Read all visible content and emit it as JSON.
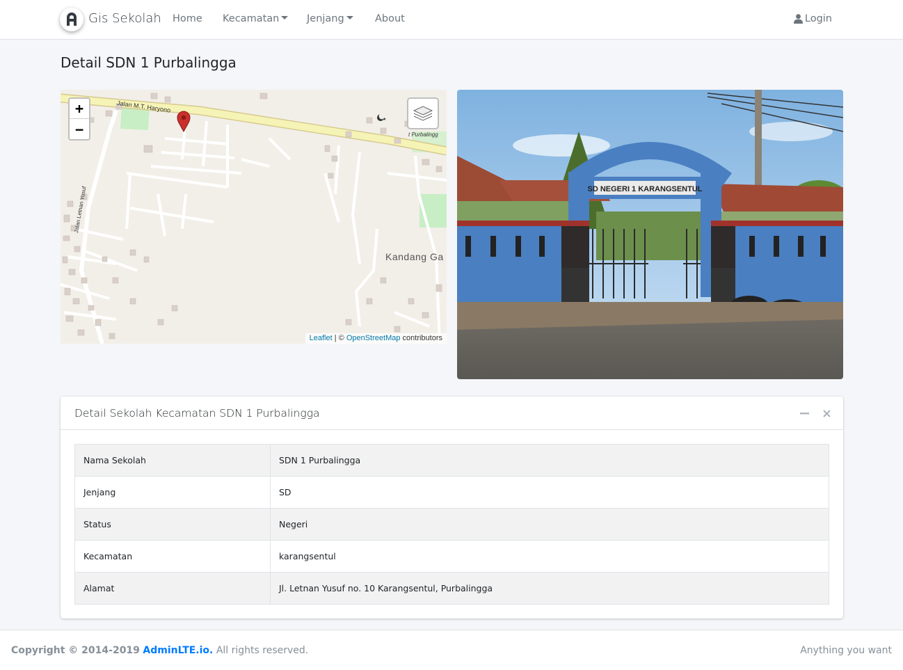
{
  "navbar": {
    "brand": "Gis Sekolah",
    "items": [
      {
        "label": "Home"
      },
      {
        "label": "Kecamatan"
      },
      {
        "label": "Jenjang"
      },
      {
        "label": "About"
      }
    ],
    "login_label": "Login"
  },
  "page": {
    "title": "Detail SDN 1 Purbalingga"
  },
  "map": {
    "zoom_in": "+",
    "zoom_out": "−",
    "street_label_1": "Jalan M.T. Haryono",
    "street_label_2": "Jalan Letnan Yusuf",
    "street_label_3": "t Purbalingg",
    "place_label": "Kandang Ga",
    "attribution_leaflet": "Leaflet",
    "attribution_sep": " | © ",
    "attribution_osm": "OpenStreetMap",
    "attribution_suffix": " contributors"
  },
  "photo": {
    "gate_sign": "SD NEGERI 1 KARANGSENTUL"
  },
  "detail_card": {
    "title": "Detail Sekolah Kecamatan SDN 1 Purbalingga",
    "rows": [
      {
        "key": "Nama Sekolah",
        "value": "SDN 1 Purbalingga"
      },
      {
        "key": "Jenjang",
        "value": "SD"
      },
      {
        "key": "Status",
        "value": "Negeri"
      },
      {
        "key": "Kecamatan",
        "value": "karangsentul"
      },
      {
        "key": "Alamat",
        "value": "Jl. Letnan Yusuf no. 10 Karangsentul, Purbalingga"
      }
    ]
  },
  "footer": {
    "copyright": "Copyright © 2014-2019",
    "company": "AdminLTE.io.",
    "rights": "All rights reserved.",
    "right_text": "Anything you want"
  },
  "colors": {
    "link": "#007bff",
    "marker": "#d32f2f",
    "wall_blue": "#4a7fc1",
    "wall_trim": "#a0322c"
  }
}
